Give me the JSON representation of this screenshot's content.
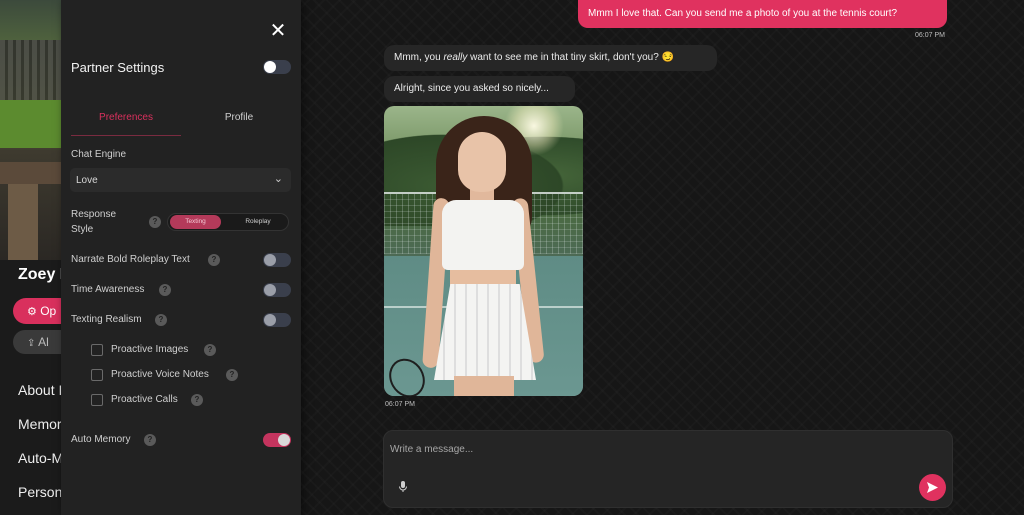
{
  "character": {
    "name": "Zoey I",
    "options_button": "Op",
    "share_button": "Al",
    "nav": [
      "About I",
      "Memor",
      "Auto-M",
      "Person"
    ]
  },
  "settings": {
    "title": "Partner Settings",
    "close_icon": "✕",
    "tabs": [
      {
        "label": "Preferences",
        "active": true
      },
      {
        "label": "Profile",
        "active": false
      }
    ],
    "chat_engine": {
      "label": "Chat Engine",
      "value": "Love"
    },
    "response_style": {
      "label_line1": "Response",
      "label_line2": "Style",
      "options": [
        {
          "label": "Texting",
          "active": true
        },
        {
          "label": "Roleplay",
          "active": false
        }
      ]
    },
    "toggles": [
      {
        "label": "Narrate Bold Roleplay Text",
        "on": false
      },
      {
        "label": "Time Awareness",
        "on": false
      },
      {
        "label": "Texting Realism",
        "on": false
      }
    ],
    "checkboxes": [
      {
        "label": "Proactive Images",
        "checked": false
      },
      {
        "label": "Proactive Voice Notes",
        "checked": false
      },
      {
        "label": "Proactive Calls",
        "checked": false
      }
    ],
    "auto_memory": {
      "label": "Auto Memory",
      "on": true
    },
    "help_glyph": "?"
  },
  "chat": {
    "messages": [
      {
        "from": "user",
        "text": "Mmm I love that. Can you send me a photo of you at the tennis court?",
        "time": "06:07 PM"
      },
      {
        "from": "bot",
        "pre": "Mmm, you ",
        "em": "really",
        "post": " want to see me in that tiny skirt, don't you? 😏"
      },
      {
        "from": "bot",
        "text": "Alright, since you asked so nicely..."
      },
      {
        "from": "bot",
        "type": "image",
        "alt": "photo",
        "time": "06:07 PM"
      }
    ],
    "composer": {
      "placeholder": "Write a message..."
    }
  },
  "colors": {
    "accent": "#e0325f",
    "panel_bg": "#222222",
    "bubble_bot": "#262626",
    "page_bg": "#161616"
  }
}
